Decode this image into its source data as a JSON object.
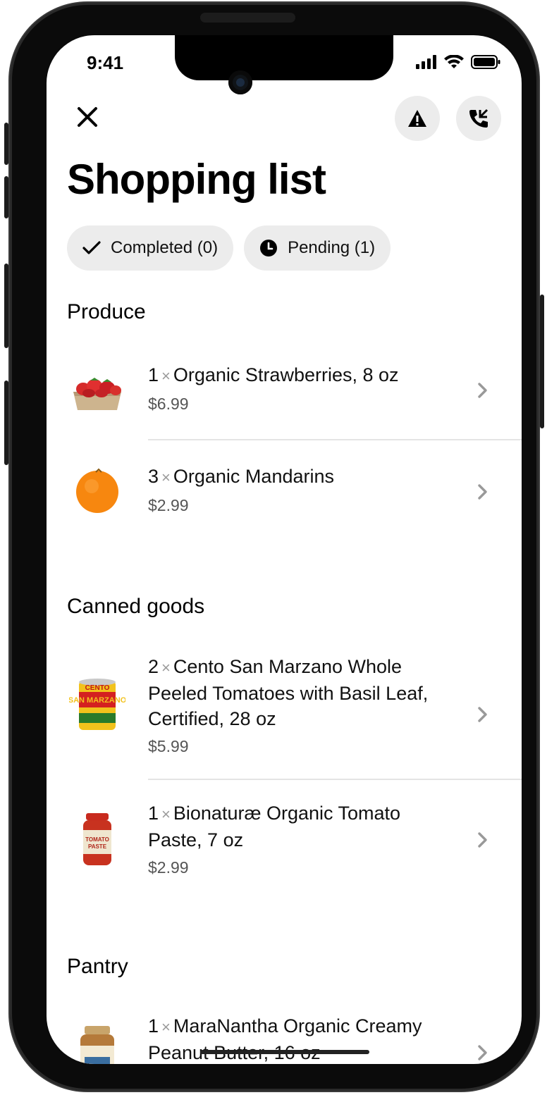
{
  "status_bar": {
    "time": "9:41"
  },
  "header": {
    "title": "Shopping list",
    "close_icon": "close-icon",
    "alert_icon": "warning-icon",
    "call_icon": "phone-call-icon"
  },
  "filters": {
    "completed": "Completed (0)",
    "pending": "Pending (1)"
  },
  "qty_separator": "×",
  "sections": [
    {
      "title": "Produce",
      "items": [
        {
          "qty": "1",
          "name": "Organic Strawberries, 8 oz",
          "price": "$6.99"
        },
        {
          "qty": "3",
          "name": "Organic Mandarins",
          "price": "$2.99"
        }
      ]
    },
    {
      "title": "Canned goods",
      "items": [
        {
          "qty": "2",
          "name": "Cento San Marzano Whole Peeled Tomatoes with Basil Leaf, Certified, 28 oz",
          "price": "$5.99"
        },
        {
          "qty": "1",
          "name": "Bionaturæ Organic Tomato Paste, 7 oz",
          "price": "$2.99"
        }
      ]
    },
    {
      "title": "Pantry",
      "items": [
        {
          "qty": "1",
          "name": "MaraNantha Organic Creamy Peanut Butter, 16 oz",
          "price": ""
        }
      ]
    }
  ],
  "colors": {
    "chip_bg": "#ececec",
    "divider": "#e4e4e4",
    "price": "#555555"
  }
}
